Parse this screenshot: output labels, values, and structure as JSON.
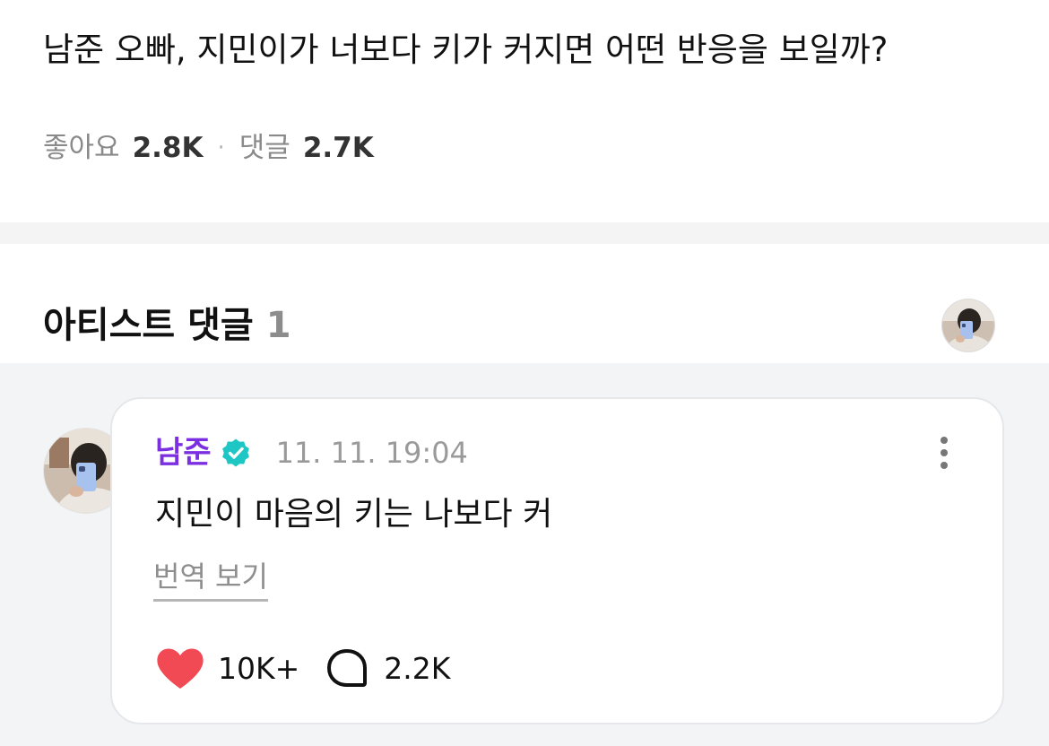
{
  "post": {
    "title": "남준 오빠, 지민이가 너보다 키가 커지면 어떤 반응을 보일까?",
    "likes_label": "좋아요",
    "likes_count": "2.8K",
    "separator": "·",
    "comments_label": "댓글",
    "comments_count": "2.7K"
  },
  "artist_section": {
    "title": "아티스트 댓글",
    "count": "1"
  },
  "comment": {
    "author": "남준",
    "timestamp": "11. 11. 19:04",
    "body": "지민이 마음의 키는 나보다 커",
    "translate_label": "번역 보기",
    "like_count": "10K+",
    "reply_count": "2.2K"
  },
  "icons": {
    "verified": "verified-badge-icon",
    "more": "more-vertical-icon",
    "like": "heart-icon",
    "reply": "speech-bubble-icon"
  },
  "colors": {
    "author_name": "#7b2fe0",
    "verified_badge": "#1fc7c4",
    "heart": "#f24a55",
    "section_background": "#f3f4f6"
  }
}
